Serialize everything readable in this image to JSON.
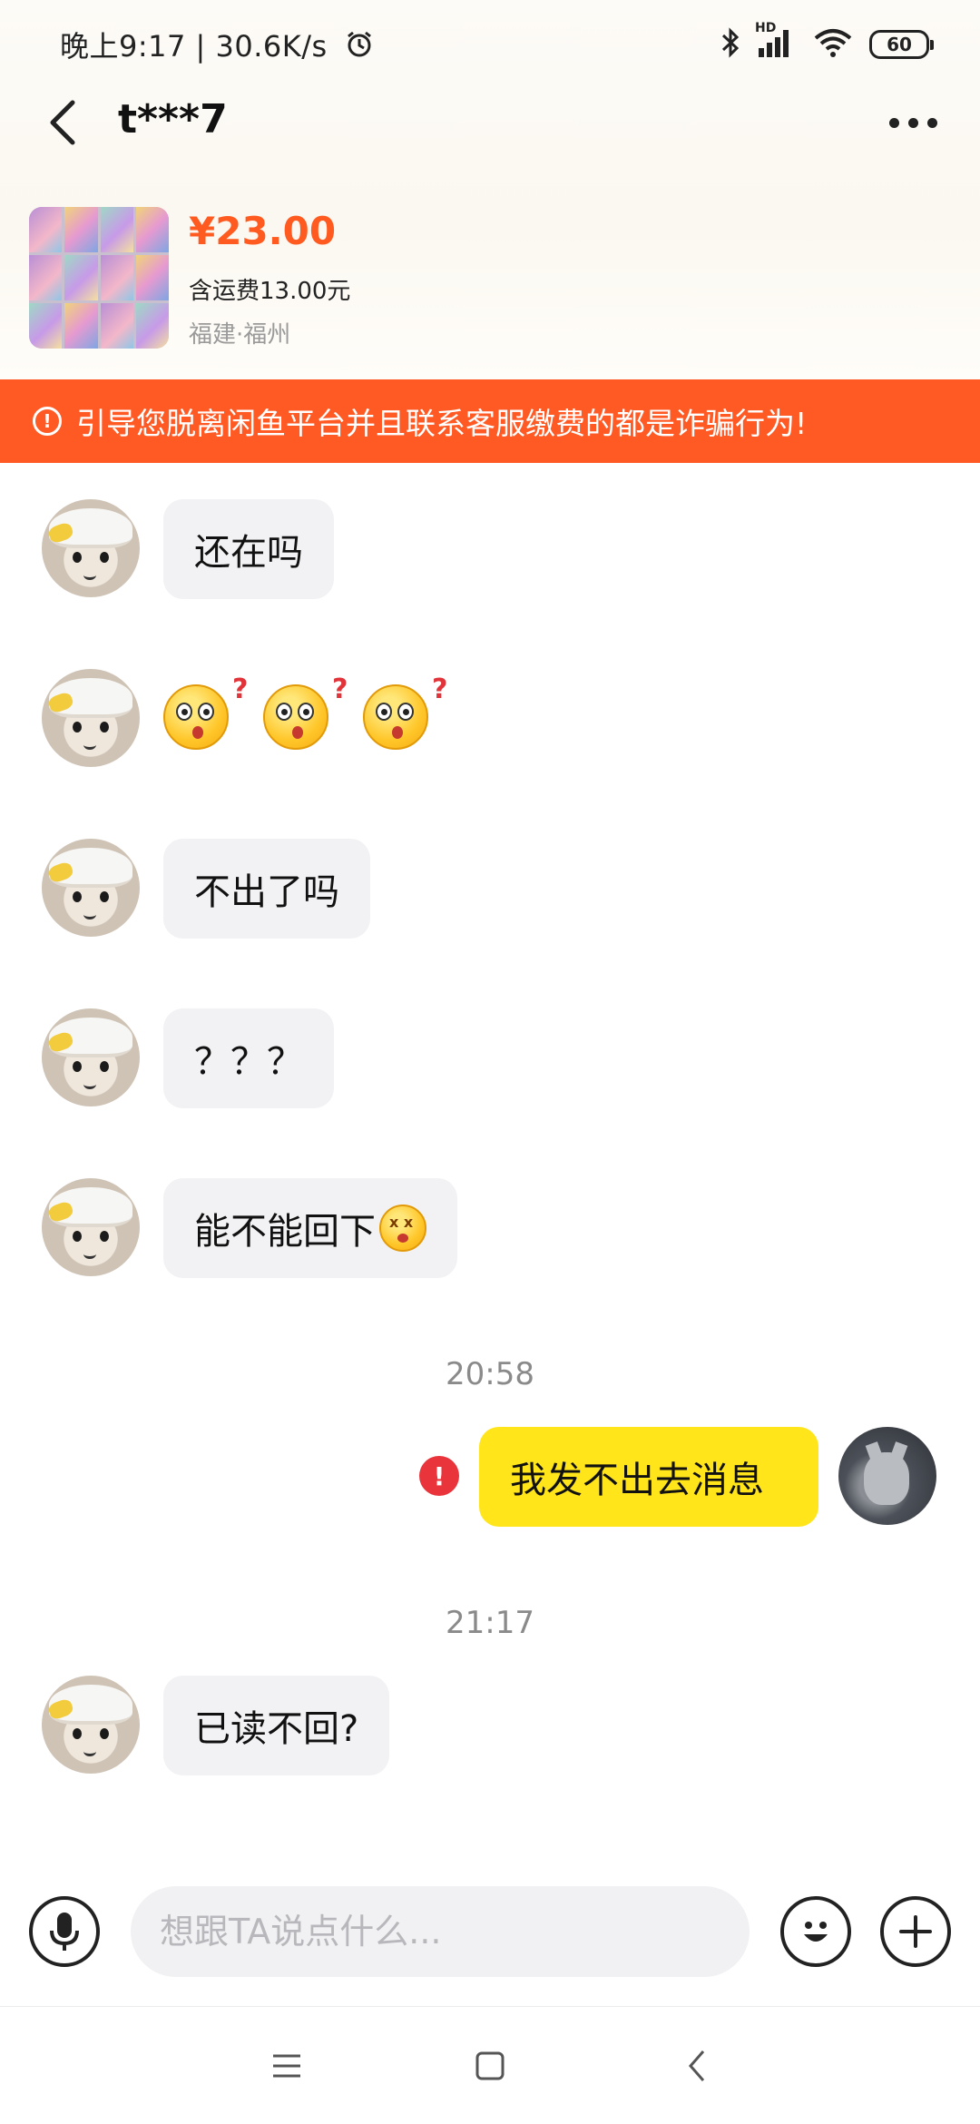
{
  "status_bar": {
    "time_speed": "晚上9:17 | 30.6K/s",
    "network_label": "HD",
    "battery": "60"
  },
  "header": {
    "title": "t***7"
  },
  "product": {
    "price": "¥23.00",
    "shipping": "含运费13.00元",
    "location": "福建·福州"
  },
  "warning": {
    "text": "引导您脱离闲鱼平台并且联系客服缴费的都是诈骗行为!",
    "icon_glyph": "!"
  },
  "messages": [
    {
      "sender": "other",
      "type": "text",
      "text": "还在吗"
    },
    {
      "sender": "other",
      "type": "emoji",
      "emoji": "confused-face-question",
      "count": 3
    },
    {
      "sender": "other",
      "type": "text",
      "text": "不出了吗"
    },
    {
      "sender": "other",
      "type": "text",
      "text": "？？？"
    },
    {
      "sender": "other",
      "type": "text",
      "text": "能不能回下",
      "trailing_emoji": "dizzy-face"
    },
    {
      "type": "timestamp",
      "text": "20:58"
    },
    {
      "sender": "me",
      "type": "text",
      "text": "我发不出去消息",
      "status": "failed",
      "status_glyph": "!"
    },
    {
      "type": "timestamp",
      "text": "21:17"
    },
    {
      "sender": "other",
      "type": "text",
      "text": "已读不回?"
    }
  ],
  "input_bar": {
    "placeholder": "想跟TA说点什么..."
  },
  "colors": {
    "accent_orange": "#ff5a24",
    "price_orange": "#ff5a1f",
    "my_bubble": "#ffe51a",
    "other_bubble": "#f2f2f4",
    "error_red": "#e8343a"
  }
}
